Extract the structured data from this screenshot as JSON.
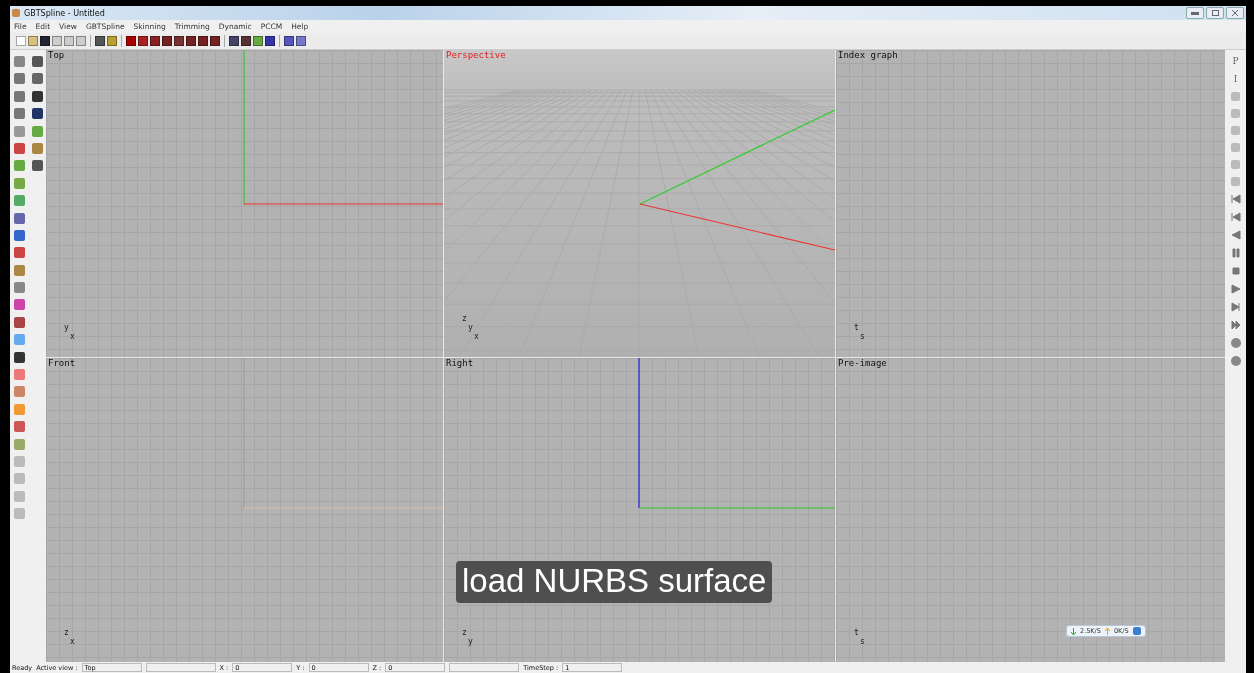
{
  "window": {
    "title": "GBTSpline - Untitled"
  },
  "menu": [
    "File",
    "Edit",
    "View",
    "GBTSpline",
    "Skinning",
    "Trimming",
    "Dynamic",
    "PCCM",
    "Help"
  ],
  "viewports": [
    {
      "kind": "top",
      "title": "Top",
      "highlighted": false,
      "axes": [
        "y",
        "x"
      ]
    },
    {
      "kind": "perspective",
      "title": "Perspective",
      "highlighted": true,
      "axes": [
        "z",
        "y",
        "x"
      ]
    },
    {
      "kind": "graph",
      "title": "Index graph",
      "highlighted": false,
      "axes": [
        "t",
        "s"
      ]
    },
    {
      "kind": "front",
      "title": "Front",
      "highlighted": false,
      "axes": [
        "z",
        "x"
      ]
    },
    {
      "kind": "right",
      "title": "Right",
      "highlighted": false,
      "axes": [
        "z",
        "y"
      ]
    },
    {
      "kind": "graph",
      "title": "Pre-image",
      "highlighted": false,
      "axes": [
        "t",
        "s"
      ]
    }
  ],
  "right_toolbar": [
    {
      "kind": "text",
      "label": "P"
    },
    {
      "kind": "text",
      "label": "I"
    }
  ],
  "caption": "load NURBS surface",
  "net_widget": {
    "down": "2.5K/S",
    "up": "0K/S"
  },
  "status_bar": [
    {
      "label": "Ready"
    },
    {
      "label": "Active view :"
    },
    {
      "value": "Top"
    },
    {
      "kind": "blank"
    },
    {
      "label": "X :"
    },
    {
      "value": "0"
    },
    {
      "label": "Y :"
    },
    {
      "value": "0"
    },
    {
      "label": "Z :"
    },
    {
      "value": "0"
    },
    {
      "kind": "blank"
    },
    {
      "label": "TimeStep :"
    },
    {
      "value": "1"
    }
  ]
}
